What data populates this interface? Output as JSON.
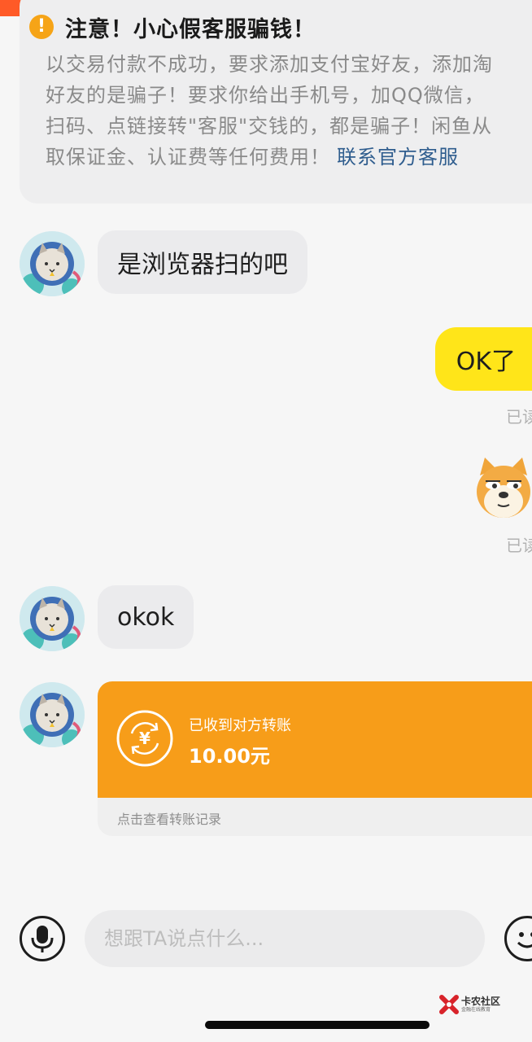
{
  "colors": {
    "top_bar": "#ff5a27",
    "incoming_bubble": "#ebebed",
    "outgoing_bubble": "#ffe519",
    "transfer_card": "#f79d19",
    "warning_link": "#2f5d8e"
  },
  "notice": {
    "icon": "exclamation-icon",
    "title": "注意！小心假客服骗钱！",
    "lines": [
      "以交易付款不成功，要求添加支付宝好友，添加淘",
      "好友的是骗子！要求你给出手机号，加QQ微信，",
      "扫码、点链接转\"客服\"交钱的，都是骗子！闲鱼从",
      "取保证金、认证费等任何费用！"
    ],
    "link_text": "联系官方客服"
  },
  "messages": [
    {
      "from": "other",
      "text": "是浏览器扫的吧"
    },
    {
      "from": "me",
      "text": "OK了",
      "status": "已读"
    },
    {
      "from": "me",
      "sticker": "shiba-dog-sticker",
      "status": "已读"
    },
    {
      "from": "other",
      "text": "okok"
    },
    {
      "from": "other",
      "transfer": {
        "icon": "yuan-transfer-icon",
        "status": "已收到对方转账",
        "amount": "10.00元",
        "footer": "点击查看转账记录"
      }
    }
  ],
  "input_bar": {
    "voice_icon": "microphone-icon",
    "placeholder": "想跟TA说点什么...",
    "emoji_icon": "smiley-icon"
  },
  "watermark": {
    "name": "卡农社区",
    "subtitle": "金融在线教育"
  }
}
